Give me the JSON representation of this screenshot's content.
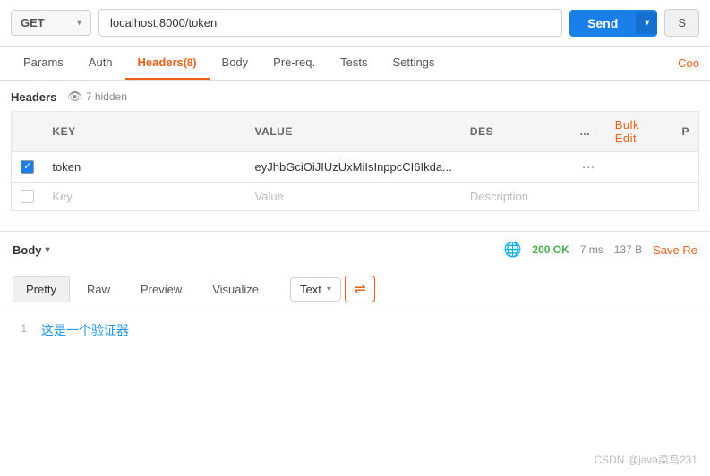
{
  "url_bar": {
    "method": "GET",
    "method_arrow": "▾",
    "url": "localhost:8000/token",
    "send_label": "Send",
    "send_arrow": "▾",
    "save_label": "S"
  },
  "req_tabs": {
    "tabs": [
      {
        "id": "params",
        "label": "Params",
        "active": false,
        "badge": null
      },
      {
        "id": "auth",
        "label": "Auth",
        "active": false,
        "badge": null
      },
      {
        "id": "headers",
        "label": "Headers",
        "active": true,
        "badge": "(8)"
      },
      {
        "id": "body",
        "label": "Body",
        "active": false,
        "badge": null
      },
      {
        "id": "prereq",
        "label": "Pre-req.",
        "active": false,
        "badge": null
      },
      {
        "id": "tests",
        "label": "Tests",
        "active": false,
        "badge": null
      },
      {
        "id": "settings",
        "label": "Settings",
        "active": false,
        "badge": null
      }
    ],
    "right_label": "Coo"
  },
  "headers_panel": {
    "title": "Headers",
    "hidden_count": "7 hidden"
  },
  "headers_table": {
    "columns": {
      "key": "KEY",
      "value": "VALUE",
      "description": "DES",
      "more": "...",
      "bulk_edit": "Bulk Edit",
      "p": "P"
    },
    "rows": [
      {
        "checked": true,
        "key": "token",
        "value": "eyJhbGciOiJIUzUxMiIsInppcCI6Ikda...",
        "description": ""
      },
      {
        "checked": false,
        "key": "",
        "key_placeholder": "Key",
        "value": "",
        "value_placeholder": "Value",
        "description": "",
        "description_placeholder": "Description"
      }
    ]
  },
  "response": {
    "body_label": "Body",
    "body_arrow": "▾",
    "status_globe": "🌐",
    "status_code": "200 OK",
    "time": "7 ms",
    "size": "137 B",
    "save_label": "Save Re",
    "tabs": [
      {
        "id": "pretty",
        "label": "Pretty",
        "active": true
      },
      {
        "id": "raw",
        "label": "Raw",
        "active": false
      },
      {
        "id": "preview",
        "label": "Preview",
        "active": false
      },
      {
        "id": "visualize",
        "label": "Visualize",
        "active": false
      }
    ],
    "format_label": "Text",
    "format_arrow": "▾",
    "wrap_icon": "⇌",
    "lines": [
      {
        "num": "1",
        "content": "这是一个验证器"
      }
    ]
  },
  "watermark": "CSDN @java菜鸟231"
}
